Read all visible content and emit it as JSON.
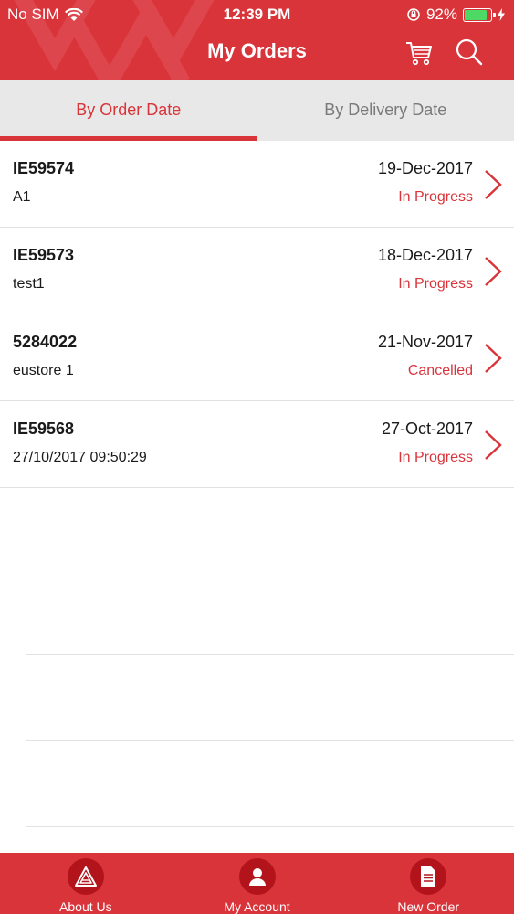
{
  "status_bar": {
    "carrier": "No SIM",
    "time": "12:39 PM",
    "battery": "92%",
    "battery_level": 0.92
  },
  "header": {
    "title": "My Orders",
    "cart_icon": "cart-icon",
    "search_icon": "search-icon"
  },
  "tabs": [
    {
      "label": "By Order Date",
      "active": true
    },
    {
      "label": "By Delivery Date",
      "active": false
    }
  ],
  "orders": [
    {
      "id": "IE59574",
      "reference": "A1",
      "date": "19-Dec-2017",
      "status": "In Progress"
    },
    {
      "id": "IE59573",
      "reference": "test1",
      "date": "18-Dec-2017",
      "status": "In Progress"
    },
    {
      "id": "5284022",
      "reference": "eustore 1",
      "date": "21-Nov-2017",
      "status": "Cancelled"
    },
    {
      "id": "IE59568",
      "reference": "27/10/2017 09:50:29",
      "date": "27-Oct-2017",
      "status": "In Progress"
    }
  ],
  "bottom_nav": [
    {
      "label": "About Us",
      "icon": "logo-icon"
    },
    {
      "label": "My Account",
      "icon": "person-icon"
    },
    {
      "label": "New Order",
      "icon": "document-icon"
    }
  ],
  "colors": {
    "brand_red": "#d9343a",
    "dark_red": "#b3141c",
    "tab_bg": "#e8e8e8",
    "battery_green": "#4cd964"
  }
}
